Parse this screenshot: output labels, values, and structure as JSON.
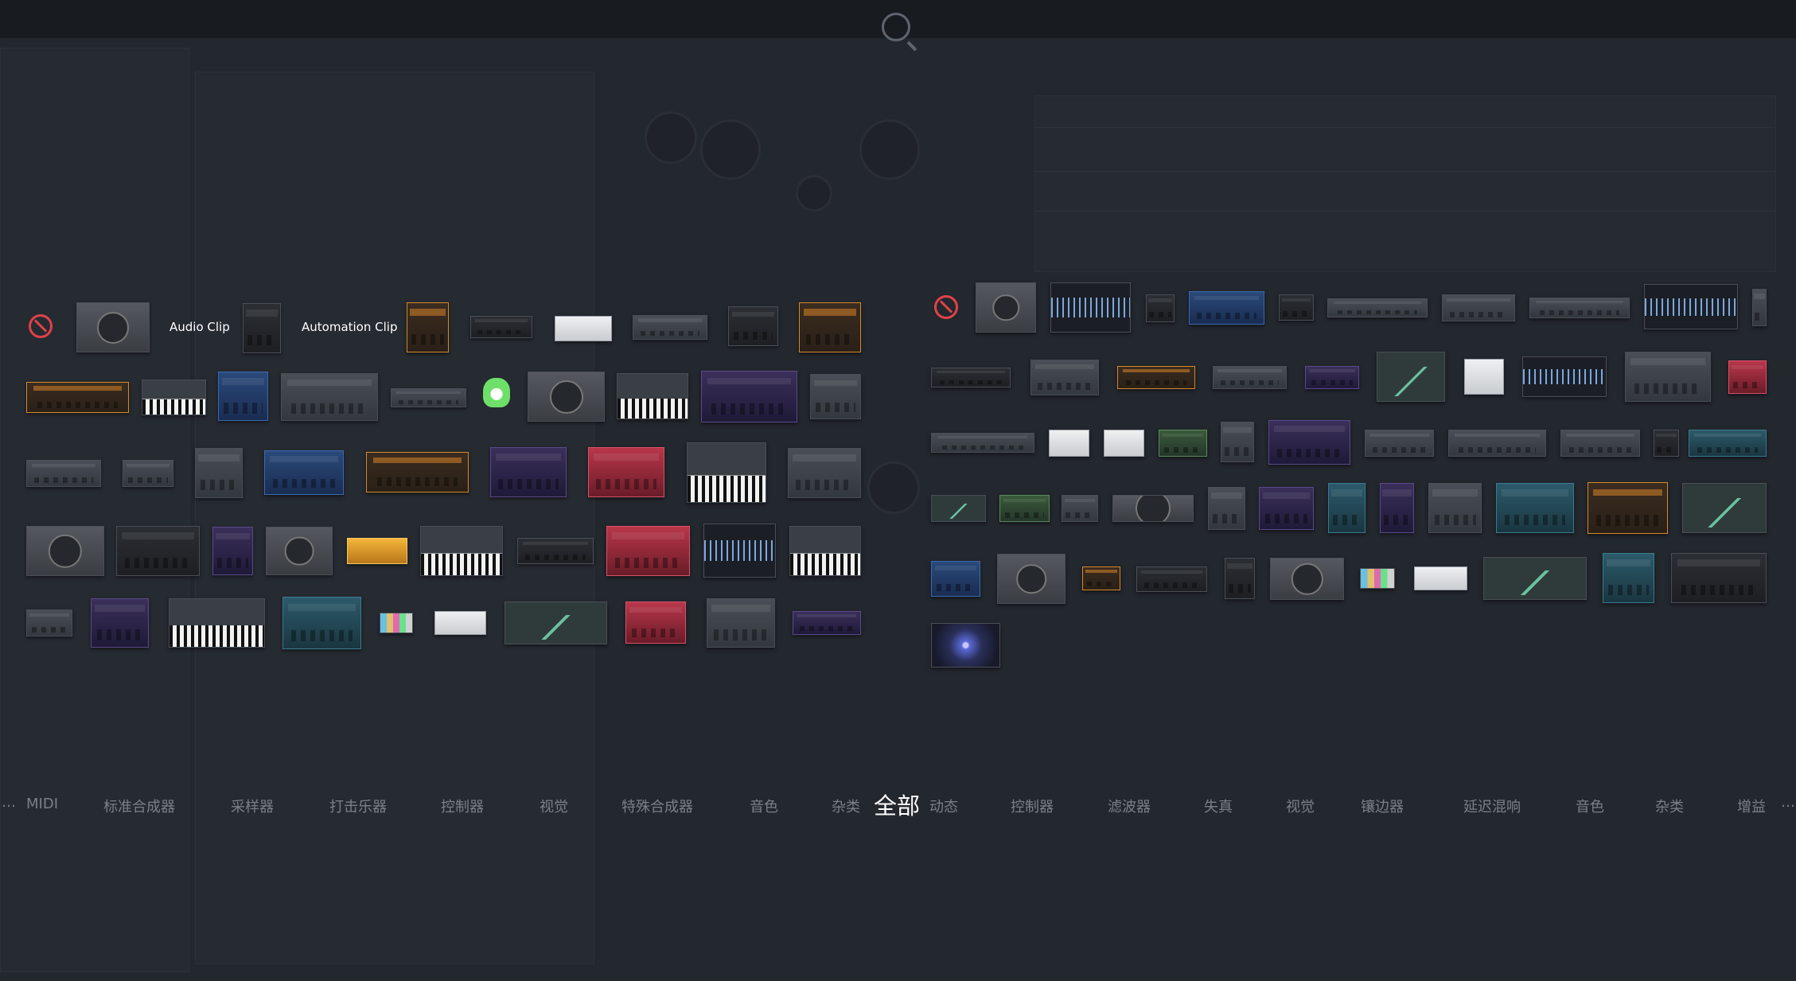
{
  "overlay": {
    "special_items": {
      "audio_clip_label": "Audio Clip",
      "automation_clip_label": "Automation Clip"
    }
  },
  "categories": {
    "left_ellipsis": "…",
    "right_ellipsis": "…",
    "generators": [
      "MIDI",
      "标准合成器",
      "采样器",
      "打击乐器",
      "控制器",
      "视觉",
      "特殊合成器",
      "音色",
      "杂类"
    ],
    "active": "全部",
    "effects": [
      "动态",
      "控制器",
      "滤波器",
      "失真",
      "视觉",
      "镶边器",
      "延迟混响",
      "音色",
      "杂类",
      "增益"
    ]
  },
  "colors": {
    "background": "#23272e",
    "category_text": "#7b8088",
    "active_text": "#ffffff",
    "no_entry_icon": "#e0424a"
  }
}
